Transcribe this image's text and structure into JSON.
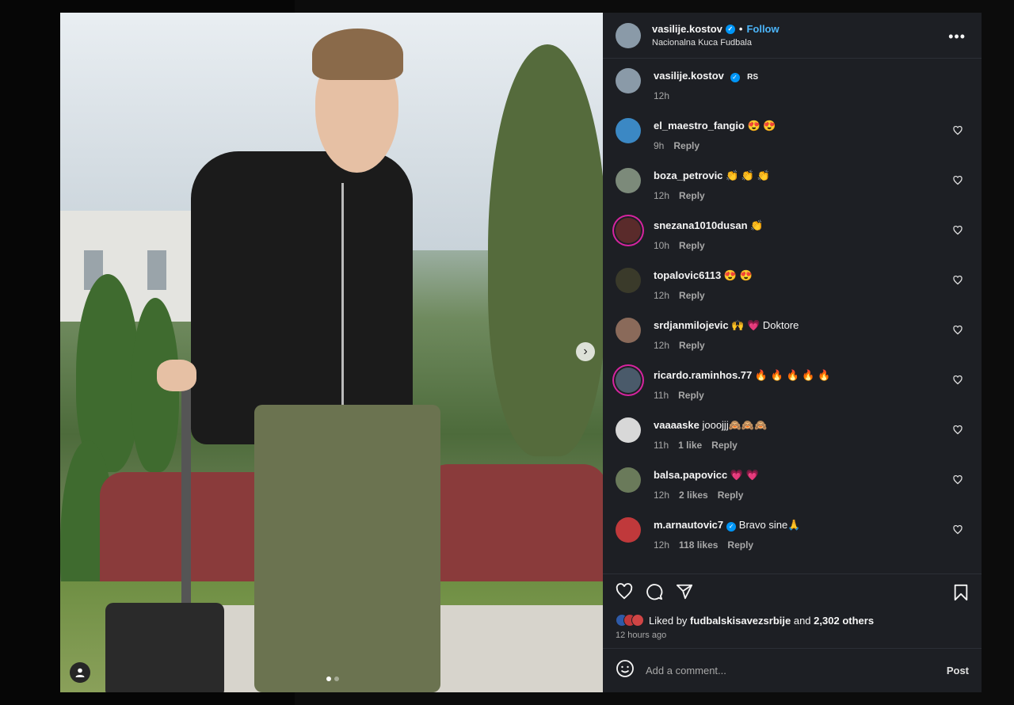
{
  "post": {
    "author": "vasilije.kostov",
    "follow_label": "Follow",
    "separator": "•",
    "location": "Nacionalna Kuca Fudbala",
    "caption_flag": "RS",
    "caption_time": "12h"
  },
  "comments": [
    {
      "user": "el_maestro_fangio",
      "text": "😍 😍",
      "time": "9h",
      "likes": "",
      "reply": "Reply",
      "avatar_color": "#3b88c4"
    },
    {
      "user": "boza_petrovic",
      "text": "👏 👏 👏",
      "time": "12h",
      "likes": "",
      "reply": "Reply",
      "avatar_color": "#7c8a7a"
    },
    {
      "user": "snezana1010dusan",
      "text": "👏",
      "time": "10h",
      "likes": "",
      "reply": "Reply",
      "avatar_color": "#5a2b2b"
    },
    {
      "user": "topalovic6113",
      "text": "😍 😍",
      "time": "12h",
      "likes": "",
      "reply": "Reply",
      "avatar_color": "#3a3a2a"
    },
    {
      "user": "srdjanmilojevic",
      "text": "🙌 💗 Doktore",
      "time": "12h",
      "likes": "",
      "reply": "Reply",
      "avatar_color": "#8a6a5a"
    },
    {
      "user": "ricardo.raminhos.77",
      "text": "🔥 🔥 🔥 🔥 🔥",
      "time": "11h",
      "likes": "",
      "reply": "Reply",
      "avatar_color": "#4a5a6a"
    },
    {
      "user": "vaaaaske",
      "text": "jooojjj🙈🙈🙈",
      "time": "11h",
      "likes": "1 like",
      "reply": "Reply",
      "avatar_color": "#d8d8d8"
    },
    {
      "user": "balsa.papovicc",
      "text": "💗 💗",
      "time": "12h",
      "likes": "2 likes",
      "reply": "Reply",
      "avatar_color": "#6a7a5a"
    },
    {
      "user": "m.arnautovic7",
      "text": "Bravo sine🙏",
      "time": "12h",
      "likes": "118 likes",
      "reply": "Reply",
      "avatar_color": "#c0393b"
    }
  ],
  "liked_by": {
    "prefix": "Liked by",
    "user": "fudbalskisavezsrbije",
    "and": "and",
    "others": "2,302 others"
  },
  "time_ago": "12 hours ago",
  "add_comment": {
    "placeholder": "Add a comment...",
    "post_label": "Post"
  },
  "icons": {
    "heart": "♡",
    "comment": "◯",
    "share": "▽",
    "bookmark": "⛉",
    "more": "•••",
    "next": "›",
    "smile": "☺"
  }
}
